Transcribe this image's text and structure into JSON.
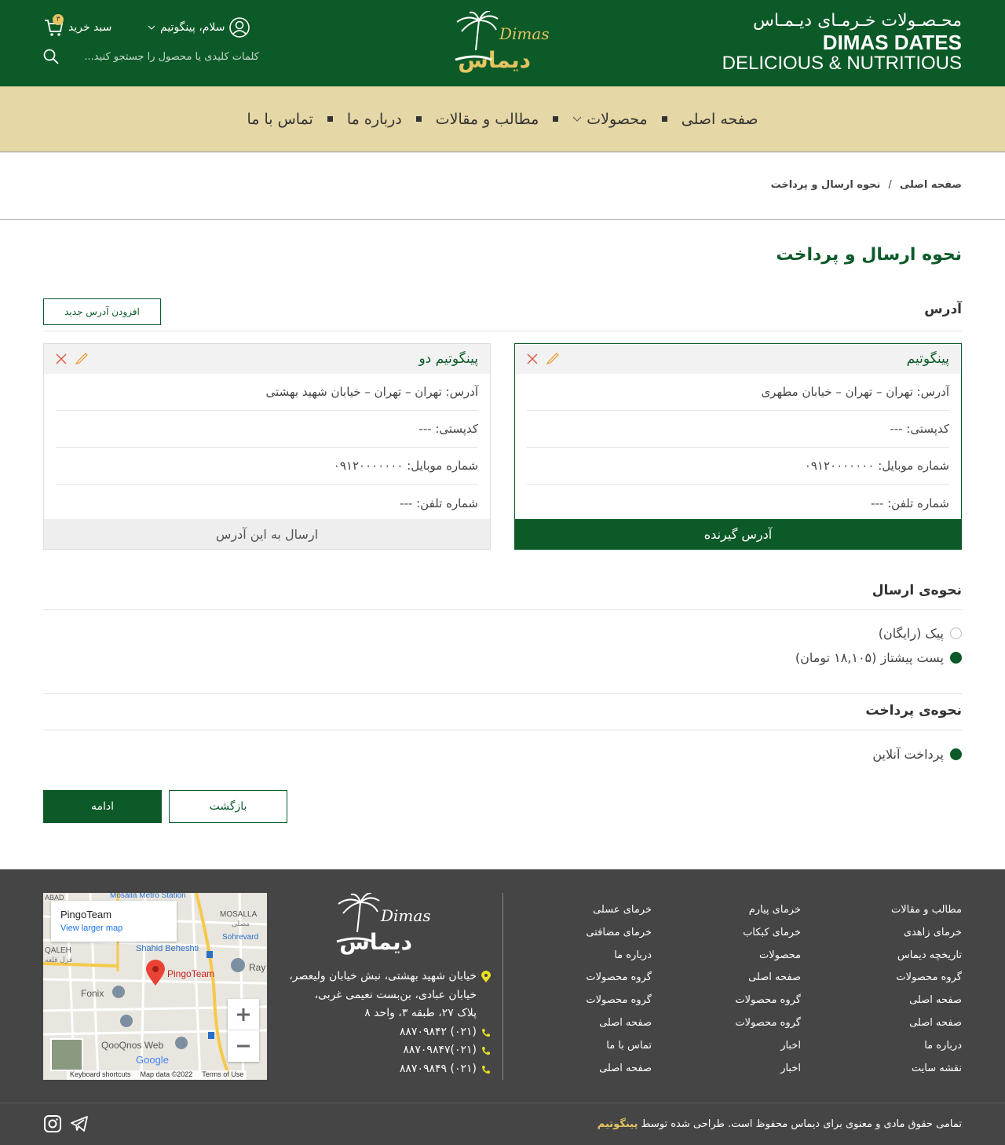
{
  "header": {
    "brand_fa": "محـصـولات خـرمـای دیـمـاس",
    "brand_en1": "DIMAS DATES",
    "brand_en2": "DELICIOUS & NUTRITIOUS",
    "logo_text_en": "Dimas",
    "logo_text_fa": "دیماس",
    "greeting": "سلام، پینگوتیم",
    "cart_label": "سبد خرید",
    "cart_count": "۳",
    "search_placeholder": "کلمات کلیدی یا محصول را جستجو کنید..."
  },
  "nav": {
    "items": [
      "صفحه اصلی",
      "محصولات",
      "مطالب و مقالات",
      "درباره ما",
      "تماس با ما"
    ]
  },
  "breadcrumb": {
    "home": "صفحه اصلی",
    "separator": "/",
    "current": "نحوه ارسال و پرداخت"
  },
  "page": {
    "title": "نحوه ارسال و پرداخت",
    "address_section": "آدرس",
    "add_address_button": "افزودن آدرس جدید",
    "addresses": [
      {
        "name": "پینگوتیم",
        "address": "آدرس: تهران – تهران – خیابان مطهری",
        "postal": "کدپستی: ---",
        "mobile": "شماره موبایل: ۰۹۱۲۰۰۰۰۰۰۰",
        "phone": "شماره تلفن: ---",
        "button": "آدرس گیرنده",
        "selected": true
      },
      {
        "name": "پینگوتیم دو",
        "address": "آدرس: تهران – تهران – خیابان شهید بهشتی",
        "postal": "کدپستی: ---",
        "mobile": "شماره موبایل: ۰۹۱۲۰۰۰۰۰۰۰",
        "phone": "شماره تلفن: ---",
        "button": "ارسال به این آدرس",
        "selected": false
      }
    ],
    "shipping_section": "نحوه‌ی ارسال",
    "shipping_options": [
      {
        "label": "پیک (رایگان)",
        "selected": false
      },
      {
        "label": "پست پیشتاز (۱۸,۱۰۵ تومان)",
        "selected": true
      }
    ],
    "payment_section": "نحوه‌ی پرداخت",
    "payment_options": [
      {
        "label": "پرداخت آنلاین",
        "selected": true
      }
    ],
    "back_button": "بازگشت",
    "continue_button": "ادامه"
  },
  "footer": {
    "col1": [
      "مطالب و مقالات",
      "خرمای زاهدی",
      "تاریخچه دیماس",
      "گروه محصولات",
      "صفحه اصلی",
      "صفحه اصلی",
      "درباره ما",
      "نقشه سایت"
    ],
    "col2": [
      "خرمای پیارم",
      "خرمای کبکاب",
      "محصولات",
      "صفحه اصلی",
      "گروه محصولات",
      "گروه محصولات",
      "اخبار",
      "اخبار"
    ],
    "col3": [
      "خرمای عسلی",
      "خرمای مضافتی",
      "درباره ما",
      "گروه محصولات",
      "گروه محصولات",
      "صفحه اصلی",
      "تماس با ما",
      "صفحه اصلی"
    ],
    "address_line1": "خیابان شهید بهشتی، نبش خیابان ولیعصر،",
    "address_line2": "خیابان عبادی، بن‌بست نعیمی غربی،",
    "address_line3": "پلاک ۲۷، طبقه ۳، واحد ۸",
    "phones": [
      "(۰۲۱) ۸۸۷۰۹۸۴۲",
      "(۰۲۱)۸۸۷۰۹۸۴۷",
      "(۰۲۱) ۸۸۷۰۹۸۴۹"
    ],
    "map": {
      "place": "PingoTeam",
      "larger": "View larger map",
      "labels": [
        "ABAD",
        "Mosalla Metro Station",
        "MOSALLA",
        "مصلی",
        "Sohrevard",
        "QALEH",
        "قزل قلعه",
        "Shahid Beheshti",
        "Ray",
        "Fonix",
        "QooQnos Web",
        "Google"
      ],
      "credits": [
        "Keyboard shortcuts",
        "Map data ©2022",
        "Terms of Use"
      ]
    },
    "copyright_pre": "تمامی حقوق مادی و معنوی برای دیماس محفوظ است. طراحی شده توسط",
    "copyright_brand": "پینگوتیم"
  },
  "colors": {
    "primary": "#0c5a28",
    "nav_bg": "#e5d7a6",
    "footer_bg": "#454545",
    "accent_yellow": "#e5c462",
    "delete_red": "#e05a4a",
    "edit_orange": "#e8a040"
  }
}
